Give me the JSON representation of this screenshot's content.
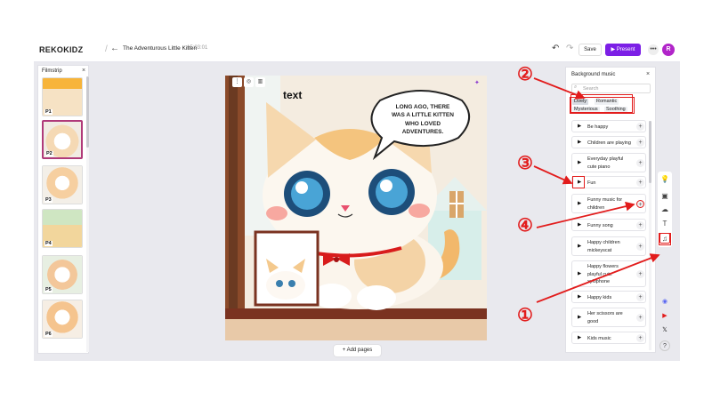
{
  "topbar": {
    "logo": "REKOKIDZ",
    "separator": "/",
    "back_icon": "arrow-left-icon",
    "doc_title": "The Adventurous Little Kitten",
    "doc_time": "15:03:01",
    "undo_icon": "undo-icon",
    "redo_icon": "redo-icon",
    "save_label": "Save",
    "present_label": "▶ Present",
    "more_label": "•••",
    "avatar_letter": "R",
    "avatar_color": "#b125c9",
    "accent": "#7c1fe6"
  },
  "filmstrip": {
    "title": "Filmstrip",
    "close": "×",
    "pages": [
      {
        "label": "P1"
      },
      {
        "label": "P2"
      },
      {
        "label": "P3"
      },
      {
        "label": "P4"
      },
      {
        "label": "P5"
      },
      {
        "label": "P6"
      }
    ]
  },
  "canvas": {
    "text_box": "text",
    "speech_bubble": "Long ago, there was a little kitten who loved adventures.",
    "add_pages": "+ Add pages"
  },
  "music_panel": {
    "title": "Background music",
    "close": "×",
    "search_placeholder": "Search",
    "tags": [
      {
        "label": "Lively",
        "active": true
      },
      {
        "label": "Romantic",
        "active": false
      },
      {
        "label": "Mysterious",
        "active": false
      },
      {
        "label": "Soothing",
        "active": false
      }
    ],
    "tracks": [
      {
        "name": "Be happy"
      },
      {
        "name": "Children are playing"
      },
      {
        "name": "Everyday playful cute piano"
      },
      {
        "name": "Fun"
      },
      {
        "name": "Funny music for children"
      },
      {
        "name": "Funny song"
      },
      {
        "name": "Happy children mickeyscat"
      },
      {
        "name": "Happy flowers playful cute xylophone"
      },
      {
        "name": "Happy kids"
      },
      {
        "name": "Her scissors are good"
      },
      {
        "name": "Kids music"
      }
    ],
    "add_label": "+",
    "play_label": "▶"
  },
  "right_rail": {
    "tools": [
      {
        "icon": "lightbulb-icon",
        "glyph": "💡"
      },
      {
        "icon": "image-icon",
        "glyph": "▣"
      },
      {
        "icon": "cloud-upload-icon",
        "glyph": "☁"
      },
      {
        "icon": "text-icon",
        "glyph": "T"
      },
      {
        "icon": "music-note-icon",
        "glyph": "♫"
      }
    ],
    "social": [
      {
        "icon": "discord-icon",
        "glyph": "◉",
        "color": "#5865f2"
      },
      {
        "icon": "youtube-icon",
        "glyph": "▶",
        "color": "#e21c1c"
      },
      {
        "icon": "x-icon",
        "glyph": "𝕏",
        "color": "#111111"
      },
      {
        "icon": "help-icon",
        "glyph": "?",
        "color": "#444444"
      }
    ]
  },
  "annotations": {
    "color": "#e21c1c",
    "numbers": [
      "①",
      "②",
      "③",
      "④"
    ]
  }
}
